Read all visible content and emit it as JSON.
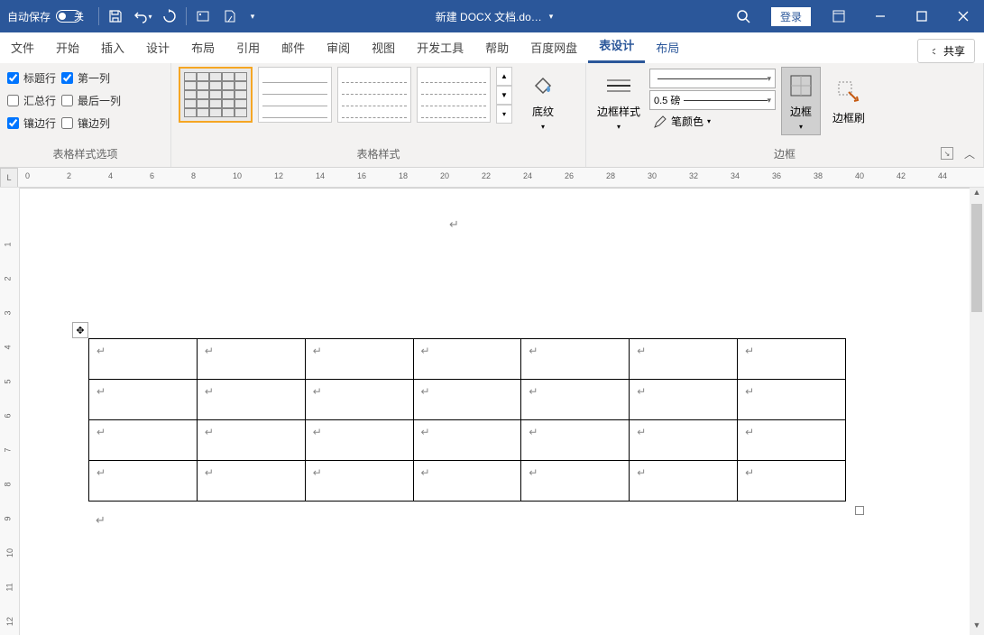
{
  "titlebar": {
    "autosave_label": "自动保存",
    "autosave_state": "关",
    "doc_title": "新建 DOCX 文档.do…",
    "login": "登录"
  },
  "tabs": {
    "file": "文件",
    "home": "开始",
    "insert": "插入",
    "design": "设计",
    "layout": "布局",
    "references": "引用",
    "mail": "邮件",
    "review": "审阅",
    "view": "视图",
    "devtools": "开发工具",
    "help": "帮助",
    "baidu": "百度网盘",
    "table_design": "表设计",
    "table_layout": "布局",
    "share": "共享"
  },
  "ribbon": {
    "style_options": {
      "header_row": "标题行",
      "first_col": "第一列",
      "total_row": "汇总行",
      "last_col": "最后一列",
      "banded_row": "镶边行",
      "banded_col": "镶边列",
      "group": "表格样式选项"
    },
    "table_styles": {
      "group": "表格样式",
      "shading": "底纹"
    },
    "borders": {
      "border_styles": "边框样式",
      "weight": "0.5 磅",
      "pen_color": "笔颜色",
      "border_btn": "边框",
      "border_painter": "边框刷",
      "group": "边框"
    }
  },
  "ruler": {
    "corner": "L"
  }
}
